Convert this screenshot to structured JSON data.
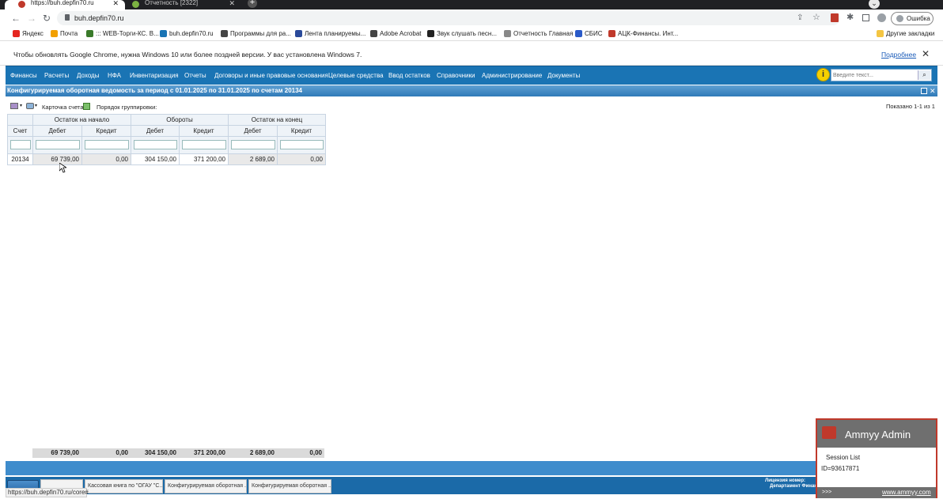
{
  "browser": {
    "tabs": [
      {
        "label": "https://buh.depfin70.ru"
      },
      {
        "label": "Отчетность [2322]"
      }
    ],
    "url": "buh.depfin70.ru",
    "error_label": "Ошибка",
    "bookmarks": [
      {
        "label": "Яндекс",
        "color": "#e52620"
      },
      {
        "label": "Почта",
        "color": "#f2a000"
      },
      {
        "label": "::: WEB-Торги-КС. В...",
        "color": "#3a7a2a"
      },
      {
        "label": "buh.depfin70.ru",
        "color": "#1a74b4"
      },
      {
        "label": "Программы для ра...",
        "color": "#444444"
      },
      {
        "label": "Лента планируемы...",
        "color": "#2a4a9a"
      },
      {
        "label": "Adobe Acrobat",
        "color": "#444444"
      },
      {
        "label": "Звук слушать песн...",
        "color": "#222222"
      },
      {
        "label": "Отчетность Главная",
        "color": "#888888"
      },
      {
        "label": "СБИС",
        "color": "#2a5ac8"
      },
      {
        "label": "АЦК-Финансы. Инт...",
        "color": "#c0392b"
      }
    ],
    "other_bookmarks": "Другие закладки",
    "info_message": "Чтобы обновлять Google Chrome, нужна Windows 10 или более поздней версии. У вас установлена Windows 7.",
    "info_link": "Подробнее"
  },
  "menu": [
    "Финансы",
    "Расчеты",
    "Доходы",
    "НФА",
    "Инвентаризация",
    "Отчеты",
    "Договоры и иные правовые основания",
    "Целевые средства",
    "Ввод остатков",
    "Справочники",
    "Администрирование",
    "Документы"
  ],
  "search_placeholder": "Введите текст...",
  "window_title": "Конфигурируемая оборотная ведомость за период с 01.01.2025 по 31.01.2025 по счетам 20134",
  "toolbar": {
    "card_label": "Карточка счета",
    "group_label": "Порядок группировки:",
    "shown": "Показано 1-1 из 1"
  },
  "table": {
    "groups": [
      "Остаток на начало",
      "Обороты",
      "Остаток на конец"
    ],
    "account_header": "Счет",
    "debit": "Дебет",
    "credit": "Кредит",
    "row": {
      "account": "20134",
      "open_debit": "69 739,00",
      "open_credit": "0,00",
      "turn_debit": "304 150,00",
      "turn_credit": "371 200,00",
      "close_debit": "2 689,00",
      "close_credit": "0,00"
    },
    "totals": {
      "open_debit": "69 739,00",
      "open_credit": "0,00",
      "turn_debit": "304 150,00",
      "turn_credit": "371 200,00",
      "close_debit": "2 689,00",
      "close_credit": "0,00"
    }
  },
  "taskbar": [
    {
      "label": "Кассовая книга по \"ОГАУ \"С..."
    },
    {
      "label": "Конфигурируемая оборотная ..."
    },
    {
      "label": "Конфигурируемая оборотная ..."
    }
  ],
  "license": {
    "line1": "Лицензия номер:",
    "line2": "Департамент Финан"
  },
  "url_tooltip": "https://buh.depfin70.ru/core#",
  "ammyy": {
    "title": "Ammyy Admin",
    "session_list": "Session List",
    "id": "ID=93617871",
    "arrows": ">>>",
    "link": "www.ammyy.com"
  }
}
